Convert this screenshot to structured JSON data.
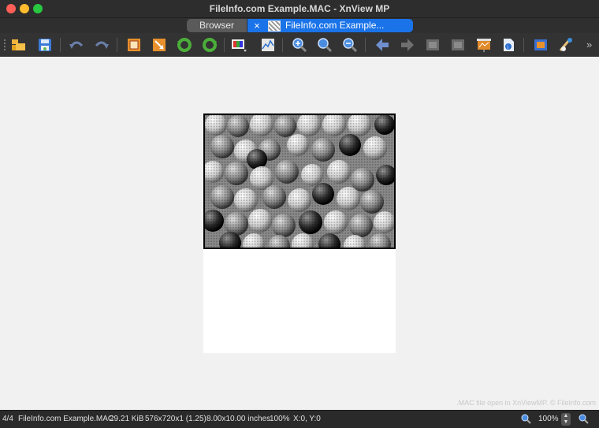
{
  "window": {
    "title": "FileInfo.com Example.MAC - XnView MP"
  },
  "tabs": {
    "browser_label": "Browser",
    "active_label": "FileInfo.com Example...",
    "close_glyph": "×"
  },
  "toolbar": {
    "buttons": [
      "open-folder-icon",
      "save-icon",
      "undo-icon",
      "redo-icon",
      "crop-icon",
      "resize-icon",
      "rotate-left-icon",
      "rotate-right-icon",
      "color-adjust-icon",
      "histogram-icon",
      "zoom-in-icon",
      "zoom-fit-icon",
      "zoom-out-icon",
      "previous-icon",
      "next-icon",
      "first-page-icon",
      "last-page-icon",
      "slideshow-icon",
      "properties-icon",
      "fullscreen-icon",
      "settings-icon"
    ],
    "overflow_glyph": "»"
  },
  "viewer": {
    "watermark": ".MAC file open in XnViewMP. © FileInfo.com"
  },
  "status": {
    "index": "4/4",
    "filename": "FileInfo.com Example.MAC",
    "filesize": "29.21 KiB",
    "dimensions": "576x720x1 (1.25)",
    "print_size": "8.00x10.00 inches",
    "zoom": "100%",
    "cursor": "X:0, Y:0",
    "zoom_right": "100%"
  },
  "colors": {
    "titlebar": "#2d2d2d",
    "active_tab": "#1a73e8",
    "close": "#ff5f57",
    "minimize": "#febc2e",
    "maximize": "#28c840"
  }
}
